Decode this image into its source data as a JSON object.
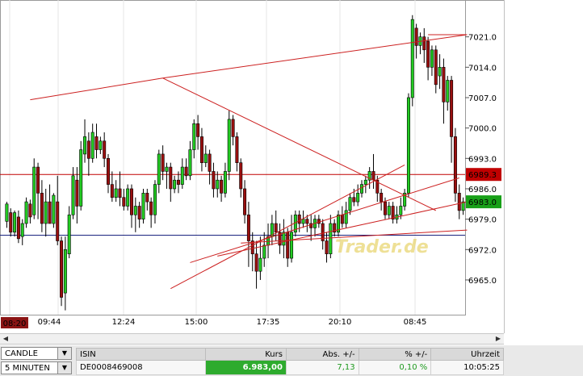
{
  "chart_data": {
    "type": "candlestick",
    "y_ticks": [
      "6965.0",
      "6972.0",
      "6979.0",
      "6986.0",
      "6993.0",
      "7000.0",
      "7007.0",
      "7014.0",
      "7021.0"
    ],
    "x_ticks": [
      "09:44",
      "12:24",
      "15:00",
      "17:35",
      "20:10",
      "08:45"
    ],
    "ylim": [
      6957,
      7028
    ],
    "start_time_label": "08:20",
    "price_labels": [
      {
        "text": "6989.3",
        "value": 6989.3,
        "color": "#c00000"
      },
      {
        "text": "6983.0",
        "value": 6983.0,
        "color": "#18a018"
      }
    ],
    "horizontal_lines": [
      {
        "value": 6989.3,
        "color": "#c00000"
      },
      {
        "value": 6975.3,
        "color": "#1a237e"
      }
    ],
    "grid": "vertical",
    "watermark": "Trader.de",
    "candles": [
      [
        6978.5,
        6982.5,
        6977,
        6983
      ],
      [
        6980.5,
        6976,
        6975,
        6981.5
      ],
      [
        6976,
        6980.5,
        6975,
        6981
      ],
      [
        6979.5,
        6974.5,
        6973.5,
        6981
      ],
      [
        6975,
        6978,
        6973,
        6979
      ],
      [
        6978,
        6983,
        6977,
        6984
      ],
      [
        6982.5,
        6979.5,
        6978,
        6983.5
      ],
      [
        6980,
        6991,
        6979,
        6993
      ],
      [
        6991,
        6985,
        6979,
        6992
      ],
      [
        6985,
        6978,
        6976,
        6988
      ],
      [
        6978,
        6983,
        6975,
        6986
      ],
      [
        6983,
        6978,
        6978,
        6987
      ],
      [
        6978,
        6984.5,
        6977,
        6985
      ],
      [
        6983,
        6974,
        6973,
        6989
      ],
      [
        6974,
        6961,
        6959,
        6975
      ],
      [
        6962,
        6972,
        6958,
        6975
      ],
      [
        6971,
        6980,
        6970,
        6982
      ],
      [
        6980,
        6989,
        6979,
        6991
      ],
      [
        6988,
        6982,
        6978,
        6991
      ],
      [
        6982,
        6995,
        6981,
        6997
      ],
      [
        6994,
        6998,
        6992,
        7002
      ],
      [
        6997,
        6993,
        6989,
        6999
      ],
      [
        6993,
        6999,
        6992,
        7001
      ],
      [
        6998,
        6995,
        6993,
        7001
      ],
      [
        6995,
        6997,
        6994,
        6998
      ],
      [
        6997,
        6993,
        6991,
        6999
      ],
      [
        6993,
        6987,
        6985,
        6994
      ],
      [
        6987,
        6984,
        6983,
        6990
      ],
      [
        6984,
        6986,
        6983,
        6988
      ],
      [
        6986,
        6984,
        6982,
        6990
      ],
      [
        6984,
        6982,
        6981,
        6986
      ],
      [
        6982,
        6986,
        6981,
        6987
      ],
      [
        6986,
        6980,
        6977,
        6987
      ],
      [
        6980,
        6982,
        6976,
        6984
      ],
      [
        6982,
        6979,
        6977,
        6983
      ],
      [
        6979,
        6985,
        6978,
        6986
      ],
      [
        6985,
        6983,
        6981,
        6986
      ],
      [
        6983,
        6980,
        6977,
        6984
      ],
      [
        6980,
        6987,
        6978,
        6988
      ],
      [
        6987,
        6994,
        6985,
        6995
      ],
      [
        6994,
        6990,
        6988,
        6996
      ],
      [
        6990,
        6991,
        6986,
        6992
      ],
      [
        6991,
        6986,
        6983,
        6992
      ],
      [
        6986,
        6988,
        6985,
        6989
      ],
      [
        6988,
        6987,
        6985,
        6990
      ],
      [
        6987,
        6991,
        6986,
        6993
      ],
      [
        6991,
        6989,
        6988,
        6993
      ],
      [
        6989,
        6995,
        6988,
        6997
      ],
      [
        6995,
        7001,
        6993,
        7002
      ],
      [
        7001,
        6998,
        6995,
        7003
      ],
      [
        6998,
        6992,
        6990,
        7000
      ],
      [
        6992,
        6994,
        6991,
        6996
      ],
      [
        6994,
        6990,
        6987,
        6995
      ],
      [
        6990,
        6986,
        6984,
        6992
      ],
      [
        6986,
        6988,
        6984,
        6990
      ],
      [
        6988,
        6985,
        6983,
        6989
      ],
      [
        6985,
        6990,
        6984,
        6992
      ],
      [
        6990,
        7002,
        6988,
        7004
      ],
      [
        7002,
        6998,
        6996,
        7003
      ],
      [
        6998,
        6992,
        6990,
        6999
      ],
      [
        6992,
        6986,
        6984,
        6993
      ],
      [
        6986,
        6980,
        6978,
        6988
      ],
      [
        6980,
        6974,
        6968,
        6983
      ],
      [
        6974,
        6971,
        6967,
        6976
      ],
      [
        6971,
        6967,
        6963,
        6974
      ],
      [
        6967,
        6970,
        6965,
        6975
      ],
      [
        6970,
        6973,
        6968,
        6976
      ],
      [
        6973,
        6975,
        6970,
        6978
      ],
      [
        6975,
        6978,
        6973,
        6980
      ],
      [
        6978,
        6976,
        6974,
        6981
      ],
      [
        6976,
        6973,
        6971,
        6978
      ],
      [
        6973,
        6976,
        6970,
        6979
      ],
      [
        6976,
        6970,
        6968,
        6977
      ],
      [
        6970,
        6976,
        6969,
        6980
      ],
      [
        6976,
        6980,
        6975,
        6981
      ],
      [
        6980,
        6978,
        6976,
        6981
      ],
      [
        6978,
        6979,
        6977,
        6981
      ],
      [
        6979,
        6978,
        6976,
        6980
      ],
      [
        6978,
        6977,
        6974,
        6980
      ],
      [
        6977,
        6979,
        6975,
        6980
      ],
      [
        6979,
        6978,
        6977,
        6980
      ],
      [
        6978,
        6974,
        6972,
        6979
      ],
      [
        6974,
        6971,
        6969,
        6976
      ],
      [
        6971,
        6978,
        6970,
        6980
      ],
      [
        6978,
        6976,
        6975,
        6979
      ],
      [
        6976,
        6980,
        6975,
        6981
      ],
      [
        6980,
        6978,
        6977,
        6982
      ],
      [
        6978,
        6981,
        6977,
        6983
      ],
      [
        6981,
        6984,
        6980,
        6985
      ],
      [
        6984,
        6983,
        6982,
        6986
      ],
      [
        6983,
        6985,
        6982,
        6987
      ],
      [
        6985,
        6987,
        6984,
        6988
      ],
      [
        6987,
        6988,
        6985,
        6989
      ],
      [
        6988,
        6990,
        6986,
        6991
      ],
      [
        6990,
        6988,
        6986,
        6994
      ],
      [
        6988,
        6985,
        6983,
        6989
      ],
      [
        6985,
        6983,
        6981,
        6986
      ],
      [
        6983,
        6980,
        6979,
        6984
      ],
      [
        6980,
        6982,
        6979,
        6983
      ],
      [
        6982,
        6979,
        6978,
        6983
      ],
      [
        6979,
        6980,
        6978,
        6982
      ],
      [
        6980,
        6982,
        6979,
        6984
      ],
      [
        6982,
        6985,
        6981,
        6986
      ],
      [
        6985,
        7007,
        6984,
        7008
      ],
      [
        7007,
        7025,
        7005,
        7026
      ],
      [
        7023,
        7019,
        7016,
        7024
      ],
      [
        7019,
        7021,
        7017,
        7022
      ],
      [
        7021,
        7018,
        7015,
        7023
      ],
      [
        7020,
        7014,
        7011,
        7021
      ],
      [
        7014,
        7018,
        7012,
        7019
      ],
      [
        7018,
        7010,
        7008,
        7019
      ],
      [
        7012,
        7014,
        7009,
        7017
      ],
      [
        7014,
        7006,
        7001,
        7016
      ],
      [
        7006,
        7011,
        7004,
        7012
      ],
      [
        7011,
        6998,
        6992,
        7012
      ],
      [
        6998,
        6985,
        6983,
        7000
      ],
      [
        6985,
        6981,
        6979,
        6987
      ],
      [
        6981,
        6983,
        6980,
        6984
      ]
    ],
    "trend_lines": [
      {
        "from": [
          6,
          7006.5
        ],
        "to": [
          40,
          7011.5
        ]
      },
      {
        "from": [
          40,
          7011.5
        ],
        "to": [
          110,
          6981
        ]
      },
      {
        "from": [
          42,
          6963
        ],
        "to": [
          102,
          6991.5
        ]
      },
      {
        "from": [
          47,
          6969
        ],
        "to": [
          116,
          6988.5
        ]
      },
      {
        "from": [
          54,
          6970.5
        ],
        "to": [
          118,
          6983
        ]
      },
      {
        "from": [
          60,
          6973.5
        ],
        "to": [
          118,
          6976.5
        ]
      },
      {
        "from": [
          40,
          7011.5
        ],
        "to": [
          118,
          7021.5
        ]
      },
      {
        "from": [
          108,
          7021.5
        ],
        "to": [
          118,
          7021.5
        ]
      }
    ]
  },
  "controls": {
    "chart_type": "CANDLE",
    "interval": "5 MINUTEN"
  },
  "quote": {
    "headers": {
      "isin": "ISIN",
      "kurs": "Kurs",
      "abs": "Abs. +/-",
      "pct": "% +/-",
      "time": "Uhrzeit"
    },
    "row": {
      "isin": "DE0008469008",
      "kurs": "6.983,00",
      "abs": "7,13",
      "pct": "0,10 %",
      "time": "10:05:25"
    }
  }
}
